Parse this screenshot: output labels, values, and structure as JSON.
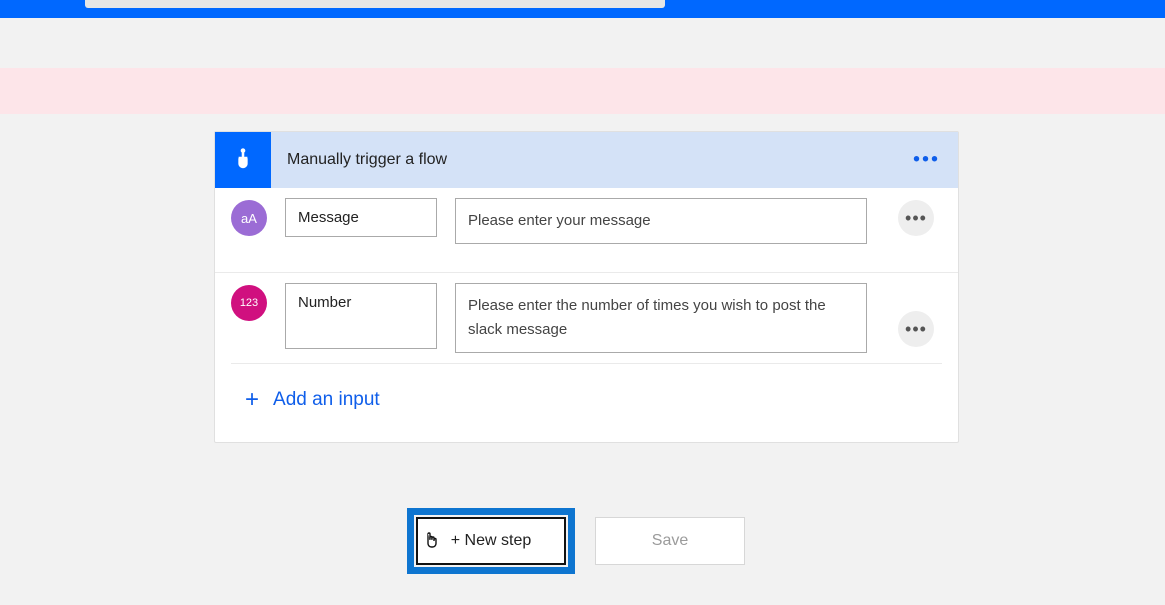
{
  "header": {
    "trigger_title": "Manually trigger a flow"
  },
  "inputs": [
    {
      "icon_text": "aA",
      "name": "Message",
      "description": "Please enter your message"
    },
    {
      "icon_text": "123",
      "name": "Number",
      "description": "Please enter the number of times you wish to post the slack message"
    }
  ],
  "add_input_label": "Add an input",
  "buttons": {
    "new_step": "+ New step",
    "save": "Save"
  }
}
